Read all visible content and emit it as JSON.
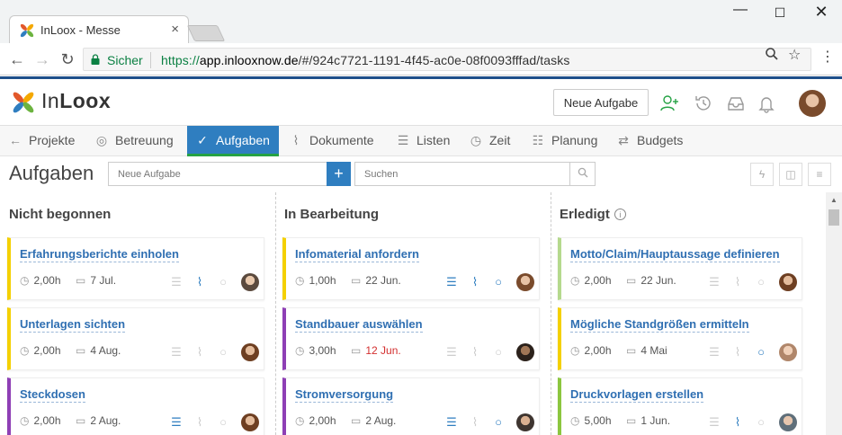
{
  "browser": {
    "tab_title": "InLoox - Messe",
    "tab_close": "×",
    "secure_label": "Sicher",
    "url_scheme": "https://",
    "url_host": "app.inlooxnow.de",
    "url_path": "/#/924c7721-1191-4f45-ac0e-08f0093fffad/tasks"
  },
  "app": {
    "logo_a": "In",
    "logo_b": "Loox",
    "new_task_button": "Neue Aufgabe"
  },
  "modules": [
    {
      "label": "Projekte",
      "icon": "arrow-left-icon"
    },
    {
      "label": "Betreuung",
      "icon": "target-icon"
    },
    {
      "label": "Aufgaben",
      "icon": "check-icon"
    },
    {
      "label": "Dokumente",
      "icon": "paperclip-icon"
    },
    {
      "label": "Listen",
      "icon": "list-icon"
    },
    {
      "label": "Zeit",
      "icon": "clock-icon"
    },
    {
      "label": "Planung",
      "icon": "planning-icon"
    },
    {
      "label": "Budgets",
      "icon": "transfer-icon"
    }
  ],
  "toolbar": {
    "title": "Aufgaben",
    "new_task_placeholder": "Neue Aufgabe",
    "add_label": "+",
    "search_placeholder": "Suchen"
  },
  "columns": [
    {
      "title": "Nicht begonnen",
      "cards": [
        {
          "title": "Erfahrungsberichte einholen",
          "hours": "2,00h",
          "date": "7 Jul.",
          "color": "#f4d000"
        },
        {
          "title": "Unterlagen sichten",
          "hours": "2,00h",
          "date": "4 Aug.",
          "color": "#f4d000"
        },
        {
          "title": "Steckdosen",
          "hours": "2,00h",
          "date": "2 Aug.",
          "color": "#8e3fb5"
        }
      ]
    },
    {
      "title": "In Bearbeitung",
      "cards": [
        {
          "title": "Infomaterial anfordern",
          "hours": "1,00h",
          "date": "22 Jun.",
          "color": "#f4d000"
        },
        {
          "title": "Standbauer auswählen",
          "hours": "3,00h",
          "date": "12 Jun.",
          "color": "#8e3fb5"
        },
        {
          "title": "Stromversorgung",
          "hours": "2,00h",
          "date": "2 Aug.",
          "color": "#8e3fb5"
        }
      ]
    },
    {
      "title": "Erledigt",
      "cards": [
        {
          "title": "Motto/Claim/Hauptaussage definieren",
          "hours": "2,00h",
          "date": "22 Jun.",
          "color": "#b5d98d"
        },
        {
          "title": "Mögliche Standgrößen ermitteln",
          "hours": "2,00h",
          "date": "4 Mai",
          "color": "#f4d000"
        },
        {
          "title": "Druckvorlagen erstellen",
          "hours": "5,00h",
          "date": "1 Jun.",
          "color": "#8cc63f"
        }
      ]
    }
  ],
  "colors": {
    "accent": "#2f7ec0",
    "active_underline": "#25a244",
    "overdue": "#d32f2f"
  }
}
